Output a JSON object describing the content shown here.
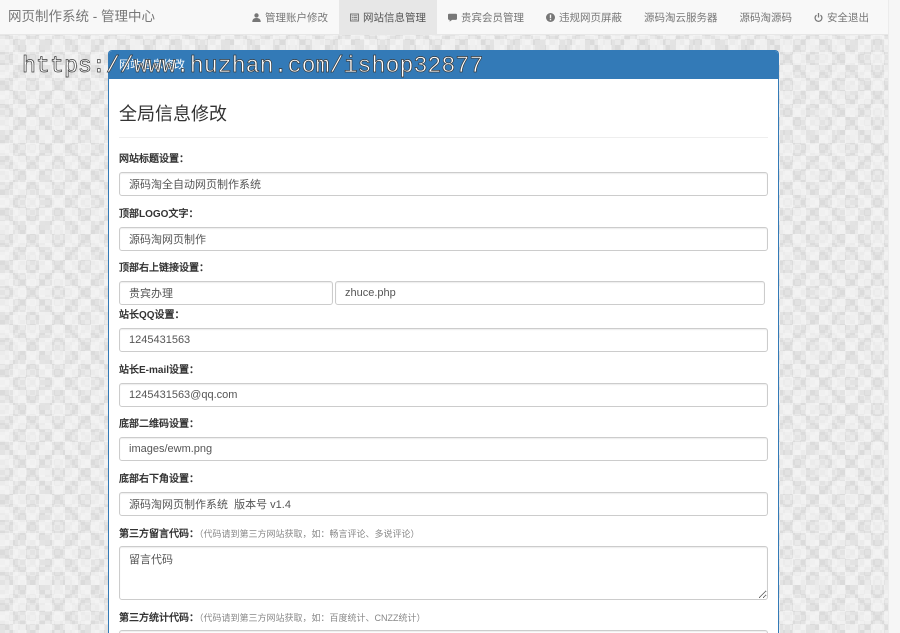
{
  "navbar": {
    "brand": "网页制作系统 - 管理中心",
    "items": [
      {
        "label": "管理账户修改",
        "icon": "user-icon",
        "active": false
      },
      {
        "label": "网站信息管理",
        "icon": "list-alt-icon",
        "active": true
      },
      {
        "label": "贵宾会员管理",
        "icon": "comment-icon",
        "active": false
      },
      {
        "label": "违规网页屏蔽",
        "icon": "exclamation-sign-icon",
        "active": false
      },
      {
        "label": "源码淘云服务器",
        "active": false
      },
      {
        "label": "源码淘源码",
        "active": false
      },
      {
        "label": "安全退出",
        "icon": "power-icon",
        "active": false
      }
    ]
  },
  "watermark": "https://www.huzhan.com/ishop32877",
  "panel": {
    "heading": "网站信息修改",
    "title": "全局信息修改"
  },
  "form": {
    "site_title": {
      "label": "网站标题设置：",
      "value": "源码淘全自动网页制作系统"
    },
    "logo_text": {
      "label": "顶部LOGO文字：",
      "value": "源码淘网页制作"
    },
    "top_link": {
      "label": "顶部右上链接设置：",
      "text_value": "贵宾办理",
      "url_value": "zhuce.php"
    },
    "qq": {
      "label": "站长QQ设置：",
      "value": "1245431563"
    },
    "email": {
      "label": "站长E-mail设置：",
      "value": "1245431563@qq.com"
    },
    "qrcode": {
      "label": "底部二维码设置：",
      "value": "images/ewm.png"
    },
    "footer_right": {
      "label": "底部右下角设置：",
      "value": "源码淘网页制作系统  版本号 v1.4"
    },
    "comment_code": {
      "label": "第三方留言代码：",
      "hint": "（代码请到第三方网站获取，如：畅言评论、多说评论）",
      "value": "留言代码"
    },
    "stats_code": {
      "label": "第三方统计代码：",
      "hint": "（代码请到第三方网站获取，如：百度统计、CNZZ统计）"
    }
  },
  "colors": {
    "primary": "#337ab7",
    "navbar_bg": "#f8f8f8",
    "nav_active_bg": "#e7e7e7"
  }
}
